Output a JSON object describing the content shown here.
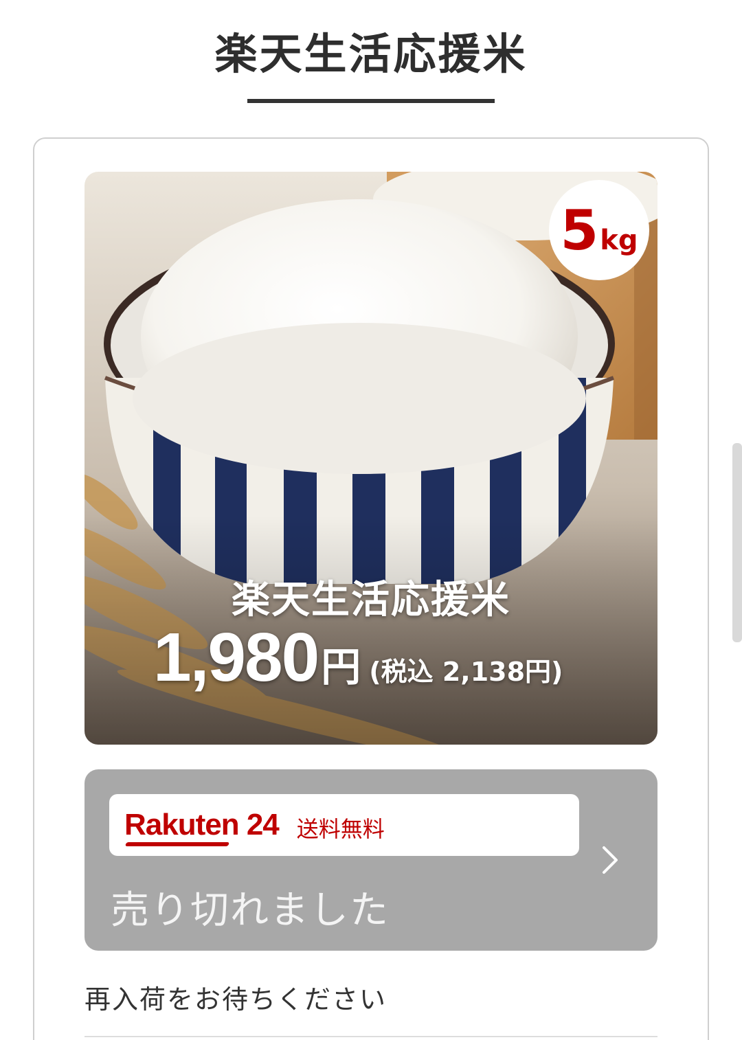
{
  "page": {
    "title": "楽天生活応援米"
  },
  "product": {
    "weight_number": "5",
    "weight_unit": "kg",
    "name": "楽天生活応援米",
    "price": "1,980",
    "price_currency": "円",
    "price_tax_included": "(税込 2,138円)"
  },
  "purchase": {
    "shop_logo_text": "Rakuten 24",
    "shipping_label": "送料無料",
    "status_text": "売り切れました",
    "chevron_icon": "chevron-right-icon"
  },
  "restock_text": "再入荷をお待ちください",
  "colors": {
    "brand_red": "#bf0000",
    "soldout_bg": "#a8a8a8"
  }
}
